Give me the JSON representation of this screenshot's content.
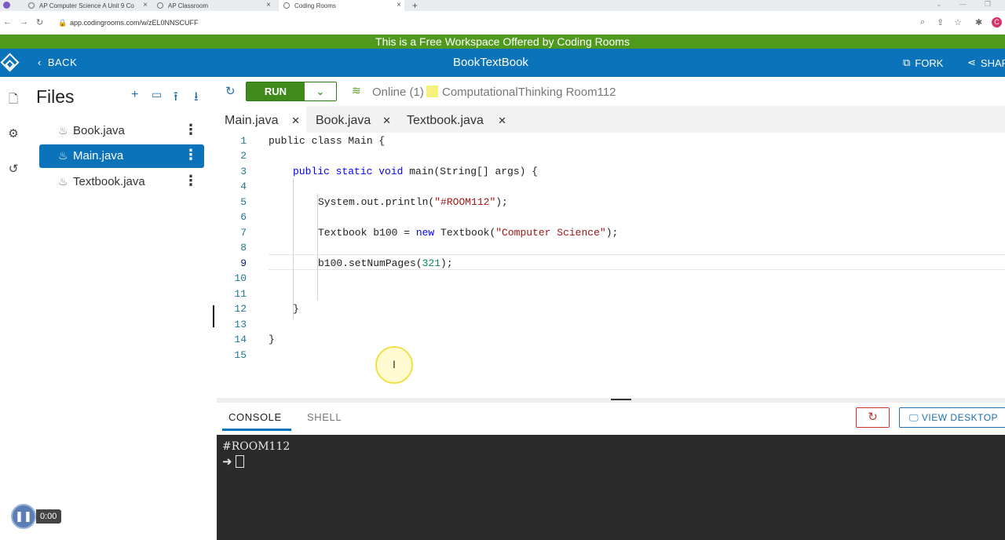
{
  "browser": {
    "tabs": [
      {
        "title": "AP Computer Science A Unit 9 Co",
        "favicon": "a-circle-icon"
      },
      {
        "title": "AP Classroom",
        "favicon": "globe-icon"
      },
      {
        "title": "Coding Rooms",
        "favicon": "globe-icon"
      }
    ],
    "url": "app.codingrooms.com/w/zEL0NNSCUFF",
    "profile_initial": "C"
  },
  "banner": "This is a Free Workspace Offered by Coding Rooms",
  "header": {
    "back_label": "BACK",
    "title": "BookTextBook",
    "fork_label": "FORK",
    "share_label": "SHAR"
  },
  "sidebar": {
    "title": "Files",
    "files": [
      {
        "name": "Book.java",
        "selected": false
      },
      {
        "name": "Main.java",
        "selected": true
      },
      {
        "name": "Textbook.java",
        "selected": false
      }
    ]
  },
  "toolbar": {
    "run_label": "RUN",
    "online_label": "Online (1)",
    "room_name": "ComputationalThinking Room112",
    "room_color": "#f6f17a"
  },
  "editor": {
    "tabs": [
      {
        "label": "Main.java",
        "active": true
      },
      {
        "label": "Book.java",
        "active": false
      },
      {
        "label": "Textbook.java",
        "active": false
      }
    ],
    "line_numbers": [
      "1",
      "2",
      "3",
      "4",
      "5",
      "6",
      "7",
      "8",
      "9",
      "10",
      "11",
      "12",
      "13",
      "14",
      "15"
    ],
    "code": {
      "l1": "public class Main {",
      "l3_kw": "public static void",
      "l3_rest": " main(String[] args) {",
      "l5_a": "System.out.println(",
      "l5_str": "\"#ROOM112\"",
      "l5_b": ");",
      "l7_a": "Textbook b100 = ",
      "l7_kw": "new",
      "l7_b": " Textbook(",
      "l7_str": "\"Computer Science\"",
      "l7_c": ");",
      "l9_a": "b100.setNumPages(",
      "l9_num": "321",
      "l9_b": ");",
      "l12": "}",
      "l14": "}"
    }
  },
  "console": {
    "tab_console": "CONSOLE",
    "tab_shell": "SHELL",
    "view_desktop_label": "VIEW DESKTOP",
    "output": "#ROOM112",
    "prompt": "➜"
  },
  "recorder": {
    "time": "0:00"
  },
  "colors": {
    "brand_blue": "#0b73b9",
    "banner_green": "#4f9a1d",
    "run_green": "#3f8a1b"
  }
}
